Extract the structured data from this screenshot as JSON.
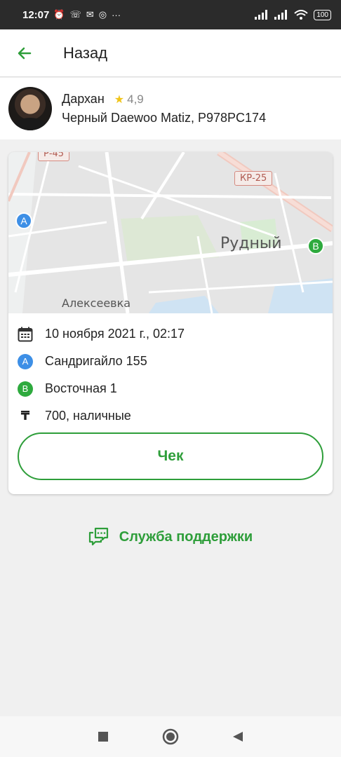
{
  "status_bar": {
    "time": "12:07",
    "battery": "100"
  },
  "app_bar": {
    "title": "Назад"
  },
  "driver": {
    "name": "Дархан",
    "rating": "4,9",
    "car": "Черный Daewoo Matiz, P978PC174"
  },
  "map": {
    "road_sign_1": "Р-45",
    "road_sign_2": "КР-25",
    "city_label": "Рудный",
    "village_label": "Алексеевка",
    "marker_a": "A",
    "marker_b": "B"
  },
  "trip": {
    "datetime": "10 ноября 2021 г., 02:17",
    "point_a_label": "A",
    "point_a": "Сандригайло 155",
    "point_b_label": "B",
    "point_b": "Восточная 1",
    "currency_symbol": "₸",
    "payment": "700, наличные"
  },
  "receipt_button": "Чек",
  "support_link": "Служба поддержки",
  "colors": {
    "accent": "#2e9e3a",
    "marker_a": "#3d8fe6",
    "marker_b": "#2eaa3e"
  }
}
